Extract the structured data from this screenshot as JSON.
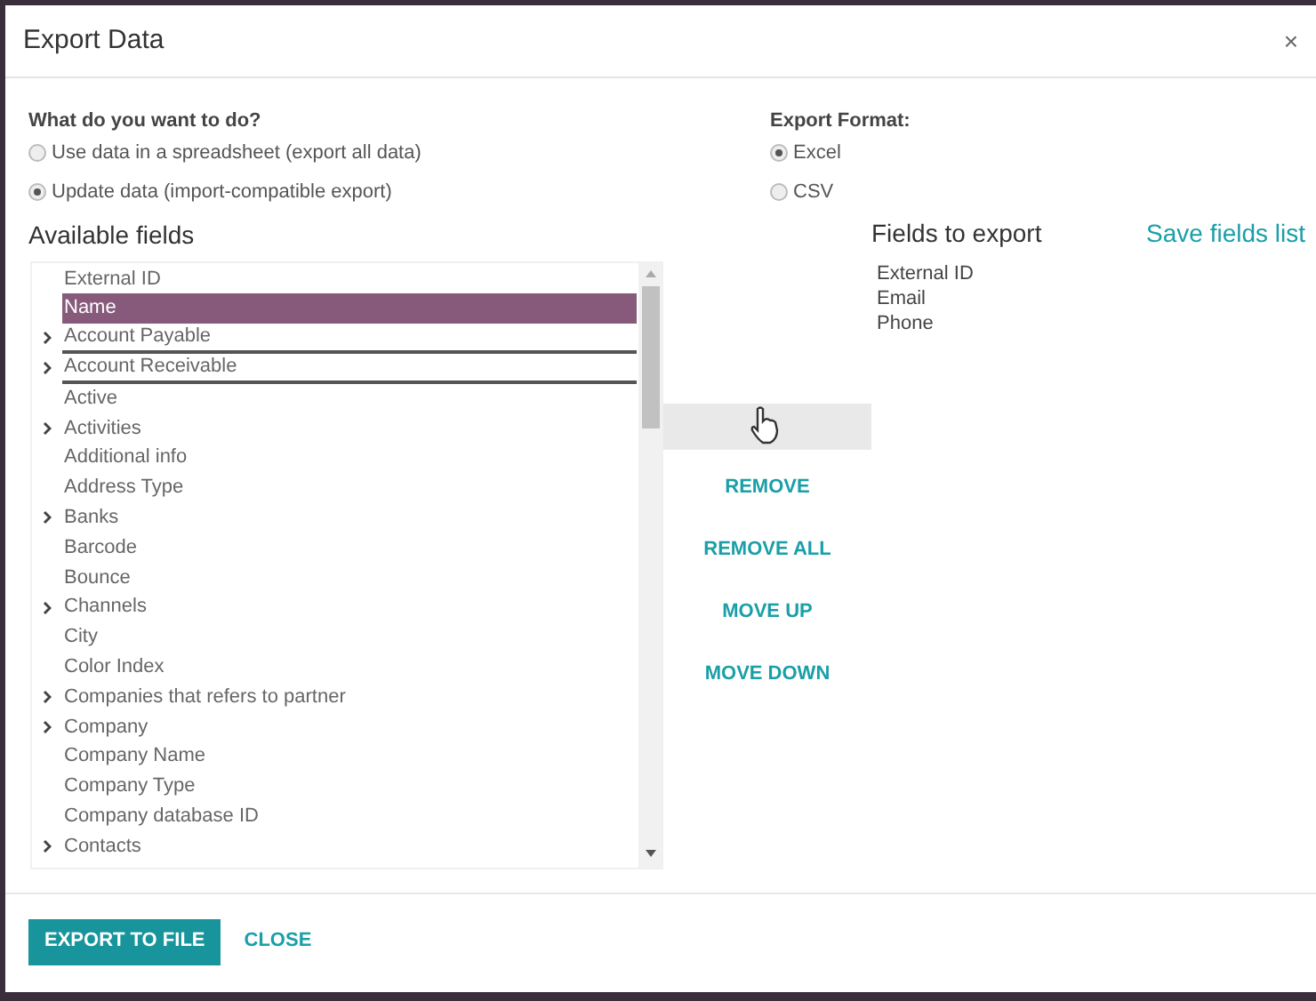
{
  "dialog": {
    "title": "Export Data",
    "close": "×"
  },
  "mode": {
    "label": "What do you want to do?",
    "options": [
      {
        "label": "Use data in a spreadsheet (export all data)",
        "selected": false
      },
      {
        "label": "Update data (import-compatible export)",
        "selected": true
      }
    ]
  },
  "format": {
    "label": "Export Format:",
    "options": [
      {
        "label": "Excel",
        "selected": true
      },
      {
        "label": "CSV",
        "selected": false
      }
    ]
  },
  "available": {
    "title": "Available fields",
    "items": [
      {
        "label": "External ID",
        "expandable": false,
        "selected": false,
        "underlined": false
      },
      {
        "label": "Name",
        "expandable": false,
        "selected": true,
        "underlined": false
      },
      {
        "label": "Account Payable",
        "expandable": true,
        "selected": false,
        "underlined": true
      },
      {
        "label": "Account Receivable",
        "expandable": true,
        "selected": false,
        "underlined": true
      },
      {
        "label": "Active",
        "expandable": false,
        "selected": false,
        "underlined": false
      },
      {
        "label": "Activities",
        "expandable": true,
        "selected": false,
        "underlined": false
      },
      {
        "label": "Additional info",
        "expandable": false,
        "selected": false,
        "underlined": false
      },
      {
        "label": "Address Type",
        "expandable": false,
        "selected": false,
        "underlined": false
      },
      {
        "label": "Banks",
        "expandable": true,
        "selected": false,
        "underlined": false
      },
      {
        "label": "Barcode",
        "expandable": false,
        "selected": false,
        "underlined": false
      },
      {
        "label": "Bounce",
        "expandable": false,
        "selected": false,
        "underlined": false
      },
      {
        "label": "Channels",
        "expandable": true,
        "selected": false,
        "underlined": false
      },
      {
        "label": "City",
        "expandable": false,
        "selected": false,
        "underlined": false
      },
      {
        "label": "Color Index",
        "expandable": false,
        "selected": false,
        "underlined": false
      },
      {
        "label": "Companies that refers to partner",
        "expandable": true,
        "selected": false,
        "underlined": false
      },
      {
        "label": "Company",
        "expandable": true,
        "selected": false,
        "underlined": false
      },
      {
        "label": "Company Name",
        "expandable": false,
        "selected": false,
        "underlined": false
      },
      {
        "label": "Company Type",
        "expandable": false,
        "selected": false,
        "underlined": false
      },
      {
        "label": "Company database ID",
        "expandable": false,
        "selected": false,
        "underlined": false
      },
      {
        "label": "Contacts",
        "expandable": true,
        "selected": false,
        "underlined": false
      }
    ]
  },
  "actions": [
    {
      "hovered": true
    },
    {
      "label": "REMOVE",
      "hovered": false
    },
    {
      "label": "REMOVE ALL",
      "hovered": false
    },
    {
      "label": "MOVE UP",
      "hovered": false
    },
    {
      "label": "MOVE DOWN",
      "hovered": false
    }
  ],
  "export": {
    "title": "Fields to export",
    "save_link": "Save fields list",
    "items": [
      "External ID",
      "Email",
      "Phone"
    ]
  },
  "footer": {
    "primary": "EXPORT TO FILE",
    "secondary": "CLOSE"
  }
}
